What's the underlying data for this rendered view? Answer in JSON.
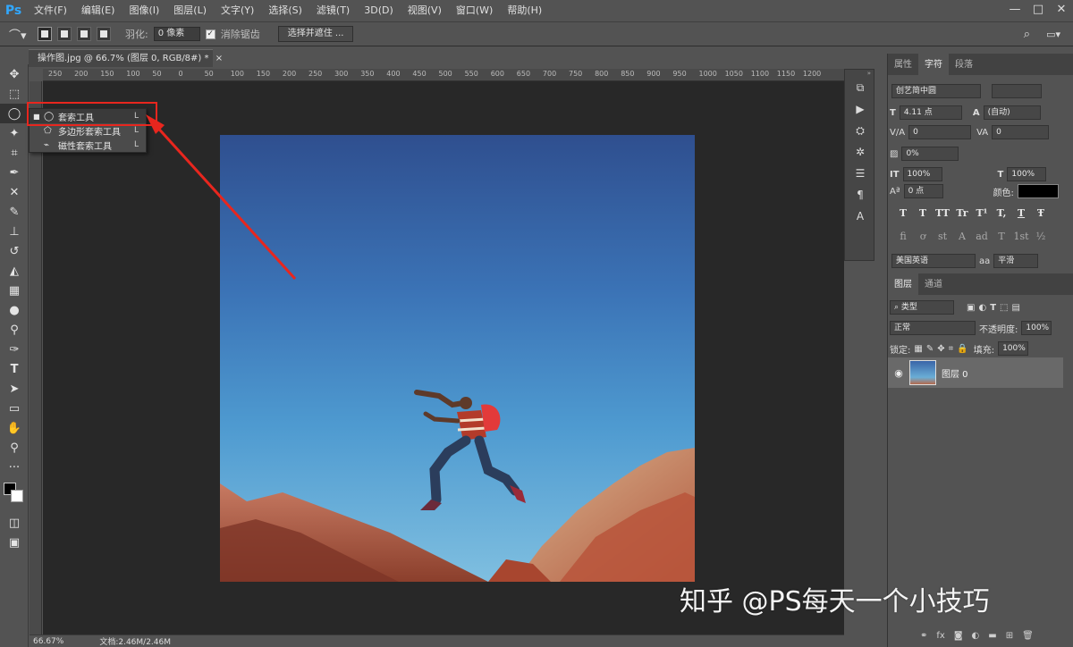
{
  "app": {
    "logo": "Ps"
  },
  "menu": [
    "文件(F)",
    "编辑(E)",
    "图像(I)",
    "图层(L)",
    "文字(Y)",
    "选择(S)",
    "滤镜(T)",
    "3D(D)",
    "视图(V)",
    "窗口(W)",
    "帮助(H)"
  ],
  "window_controls": [
    "—",
    "□",
    "✕"
  ],
  "options": {
    "feather_label": "羽化:",
    "feather_value": "0 像素",
    "antialias_label": "消除锯齿",
    "select_mask_label": "选择并遮住 ..."
  },
  "document": {
    "tab_title": "操作图.jpg @ 66.7% (图层 0, RGB/8#) *",
    "ruler_ticks": [
      "250",
      "200",
      "150",
      "100",
      "50",
      "0",
      "50",
      "100",
      "150",
      "200",
      "250",
      "300",
      "350",
      "400",
      "450",
      "500",
      "550",
      "600",
      "650",
      "700",
      "750",
      "800",
      "850",
      "900",
      "950",
      "1000",
      "1050",
      "1100",
      "1150",
      "1200"
    ],
    "zoom": "66.67%",
    "doc_info": "文档:2.46M/2.46M"
  },
  "flyout": {
    "items": [
      {
        "label": "套索工具",
        "key": "L"
      },
      {
        "label": "多边形套索工具",
        "key": "L"
      },
      {
        "label": "磁性套索工具",
        "key": "L"
      }
    ]
  },
  "panel_top": {
    "tabs": [
      "属性",
      "字符",
      "段落"
    ],
    "font_family": "创艺简中圆",
    "font_size": "4.11 点",
    "leading": "(自动)",
    "kerning": "0",
    "tracking": "0",
    "tsume": "0%",
    "vscale": "100%",
    "hscale": "100%",
    "baseline": "0 点",
    "color_label": "颜色:",
    "style_buttons": [
      "T",
      "T",
      "TT",
      "Tr",
      "T¹",
      "T,",
      "T",
      "Ŧ"
    ],
    "ot_buttons": [
      "fi",
      "ơ",
      "st",
      "A",
      "ad",
      "T",
      "1st",
      "½"
    ],
    "language": "美国英语",
    "aa_icon": "aa",
    "antialias": "平滑"
  },
  "layers": {
    "tabs": [
      "图层",
      "通道"
    ],
    "filter_kind": "类型",
    "blend_mode": "正常",
    "opacity_label": "不透明度:",
    "opacity_value": "100%",
    "lock_label": "锁定:",
    "fill_label": "填充:",
    "fill_value": "100%",
    "layer_name": "图层 0"
  },
  "watermark": "知乎 @PS每天一个小技巧",
  "colors": {
    "highlight": "#e8261e",
    "ps_blue": "#31a8ff"
  }
}
